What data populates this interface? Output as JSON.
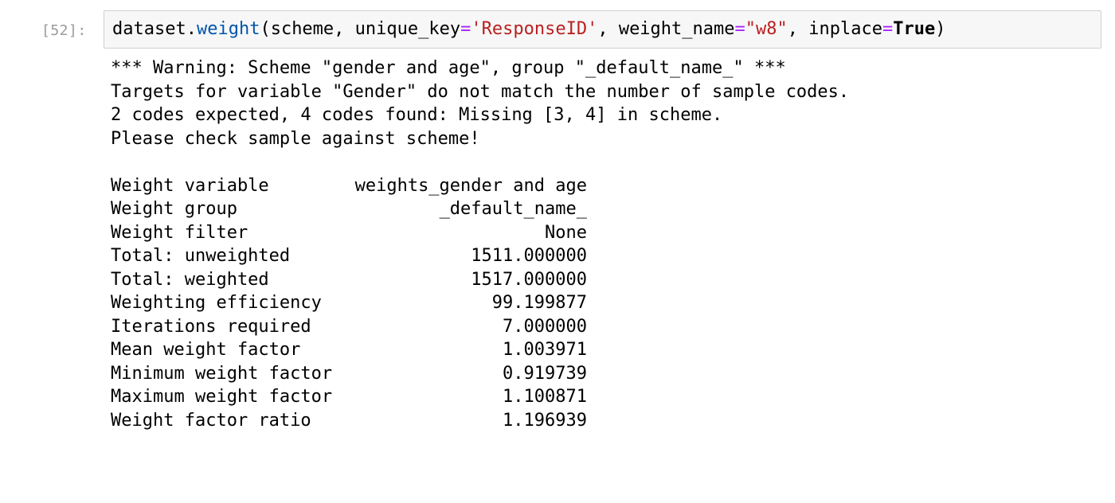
{
  "cell": {
    "prompt": "[52]:",
    "code": {
      "p1": "dataset.",
      "method": "weight",
      "p2": "(scheme, unique_key",
      "eq1": "=",
      "s1": "'ResponseID'",
      "p3": ", weight_name",
      "eq2": "=",
      "s2": "\"w8\"",
      "p4": ", inplace",
      "eq3": "=",
      "kw": "True",
      "p5": ")"
    }
  },
  "output": {
    "warning_lines": [
      "*** Warning: Scheme \"gender and age\", group \"_default_name_\" ***",
      "Targets for variable \"Gender\" do not match the number of sample codes.",
      "2 codes expected, 4 codes found: Missing [3, 4] in scheme.",
      "Please check sample against scheme!"
    ],
    "stats": [
      {
        "label": "Weight variable",
        "value": "weights_gender and age"
      },
      {
        "label": "Weight group",
        "value": "_default_name_"
      },
      {
        "label": "Weight filter",
        "value": "None"
      },
      {
        "label": "Total: unweighted",
        "value": "1511.000000"
      },
      {
        "label": "Total: weighted",
        "value": "1517.000000"
      },
      {
        "label": "Weighting efficiency",
        "value": "99.199877"
      },
      {
        "label": "Iterations required",
        "value": "7.000000"
      },
      {
        "label": "Mean weight factor",
        "value": "1.003971"
      },
      {
        "label": "Minimum weight factor",
        "value": "0.919739"
      },
      {
        "label": "Maximum weight factor",
        "value": "1.100871"
      },
      {
        "label": "Weight factor ratio",
        "value": "1.196939"
      }
    ]
  },
  "colors": {
    "prompt": "#9a9a9a",
    "input_background": "#f7f7f7",
    "input_border": "#cfcfcf",
    "attribute": "#0055aa",
    "string": "#ba2121",
    "operator": "#aa22ff"
  }
}
